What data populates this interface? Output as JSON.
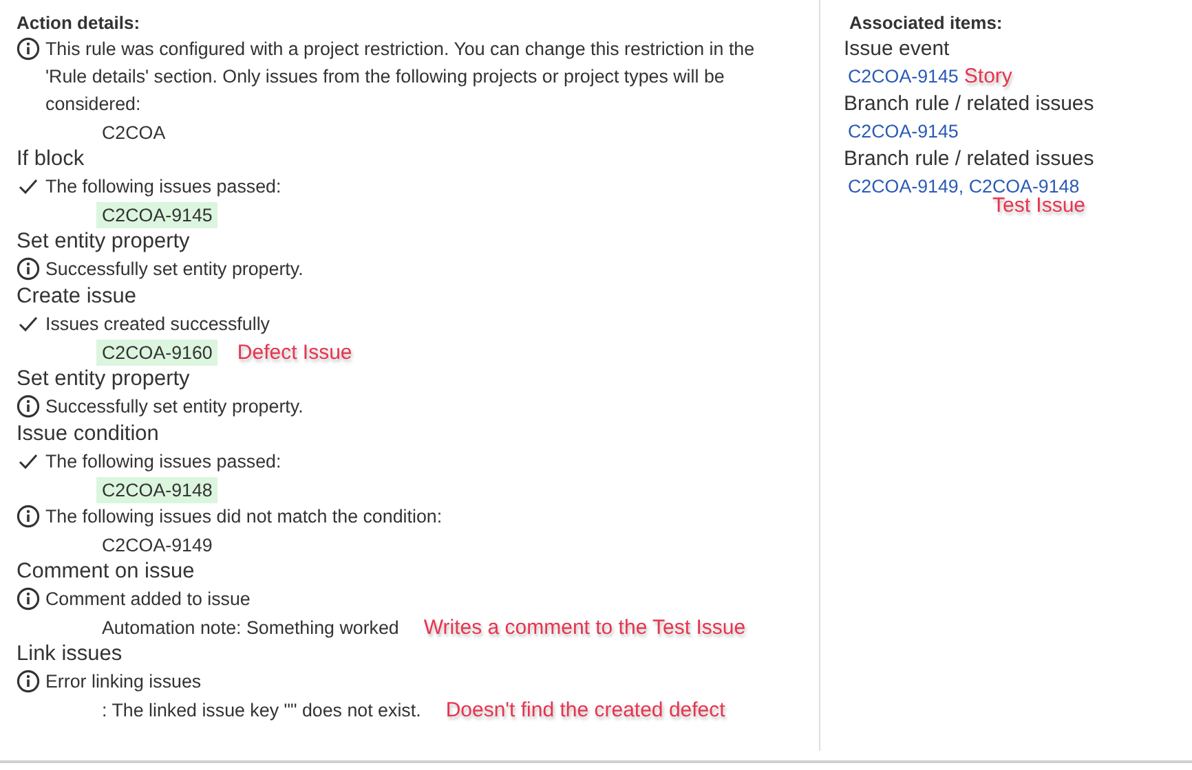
{
  "action_details": {
    "title": "Action details:",
    "intro": {
      "kind": "info",
      "text": "This rule was configured with a project restriction. You can change this restriction in the 'Rule details' section. Only issues from the following projects or project types will be considered:",
      "details": [
        {
          "text": "C2COA",
          "highlighted": false
        }
      ]
    },
    "steps": [
      {
        "name": "If block",
        "messages": [
          {
            "kind": "check",
            "text": "The following issues passed:",
            "details": [
              {
                "text": "C2COA-9145",
                "highlighted": true
              }
            ]
          }
        ]
      },
      {
        "name": "Set entity property",
        "messages": [
          {
            "kind": "info",
            "text": "Successfully set entity property."
          }
        ]
      },
      {
        "name": "Create issue",
        "messages": [
          {
            "kind": "check",
            "text": "Issues created successfully",
            "details": [
              {
                "text": "C2COA-9160",
                "highlighted": true,
                "note": "Defect Issue"
              }
            ]
          }
        ]
      },
      {
        "name": "Set entity property",
        "messages": [
          {
            "kind": "info",
            "text": "Successfully set entity property."
          }
        ]
      },
      {
        "name": "Issue condition",
        "messages": [
          {
            "kind": "check",
            "text": "The following issues passed:",
            "details": [
              {
                "text": "C2COA-9148",
                "highlighted": true
              }
            ]
          },
          {
            "kind": "info",
            "text": "The following issues did not match the condition:",
            "details": [
              {
                "text": "C2COA-9149",
                "highlighted": false
              }
            ]
          }
        ]
      },
      {
        "name": "Comment on issue",
        "messages": [
          {
            "kind": "info",
            "text": "Comment added to issue",
            "details": [
              {
                "text": "Automation note: Something worked",
                "highlighted": false,
                "note": "Writes a comment to the Test Issue"
              }
            ]
          }
        ]
      },
      {
        "name": "Link issues",
        "messages": [
          {
            "kind": "info",
            "text": "Error linking issues",
            "details": [
              {
                "text": ": The linked issue key \"\" does not exist.",
                "highlighted": false,
                "note": "Doesn't find the created defect"
              }
            ]
          }
        ]
      }
    ]
  },
  "associated_items": {
    "title": "Associated items:",
    "groups": [
      {
        "label": "Issue event",
        "links": "C2COA-9145",
        "note": "Story",
        "note_below": false
      },
      {
        "label": "Branch rule / related issues",
        "links": "C2COA-9145"
      },
      {
        "label": "Branch rule / related issues",
        "links": "C2COA-9149, C2COA-9148",
        "note": "Test Issue",
        "note_below": true
      }
    ]
  }
}
